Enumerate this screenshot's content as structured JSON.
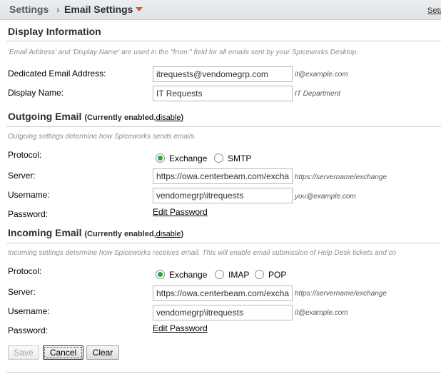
{
  "header": {
    "crumb_parent": "Settings",
    "crumb_separator": "›",
    "crumb_current": "Email Settings",
    "setup_link": "Setu"
  },
  "display": {
    "title": "Display Information",
    "desc": "'Email Address' and 'Display Name' are used in the \"from:\" field for all emails sent by your Spiceworks Desktop.",
    "email_label": "Dedicated Email Address:",
    "email_value": "itrequests@vendomegrp.com",
    "email_hint": "it@example.com",
    "name_label": "Display Name:",
    "name_value": "IT Requests",
    "name_hint": "IT Department"
  },
  "outgoing": {
    "title": "Outgoing Email",
    "status_open": "(Currently enabled,",
    "disable": "disable",
    "status_close": ")",
    "desc": "Outgoing settings determine how Spiceworks sends emails.",
    "protocol_label": "Protocol:",
    "protocol_options": [
      "Exchange",
      "SMTP"
    ],
    "protocol_selected": "Exchange",
    "server_label": "Server:",
    "server_value": "https://owa.centerbeam.com/exchange",
    "server_hint": "https://servername/exchange",
    "username_label": "Username:",
    "username_value": "vendomegrp\\itrequests",
    "username_hint": "you@example.com",
    "password_label": "Password:",
    "edit_password": "Edit Password"
  },
  "incoming": {
    "title": "Incoming Email",
    "status_open": "(Currently enabled,",
    "disable": "disable",
    "status_close": ")",
    "desc": "Incoming settings determine how Spiceworks receives email. This will enable email submission of Help Desk tickets and co",
    "protocol_label": "Protocol:",
    "protocol_options": [
      "Exchange",
      "IMAP",
      "POP"
    ],
    "protocol_selected": "Exchange",
    "server_label": "Server:",
    "server_value": "https://owa.centerbeam.com/exchange",
    "server_hint": "https://servername/exchange",
    "username_label": "Username:",
    "username_value": "vendomegrp\\itrequests",
    "username_hint": "it@example.com",
    "password_label": "Password:",
    "edit_password": "Edit Password"
  },
  "buttons": {
    "save": "Save",
    "cancel": "Cancel",
    "clear": "Clear"
  },
  "colors": {
    "accent_caret": "#e2571b",
    "radio_selected": "#2ea43a"
  }
}
